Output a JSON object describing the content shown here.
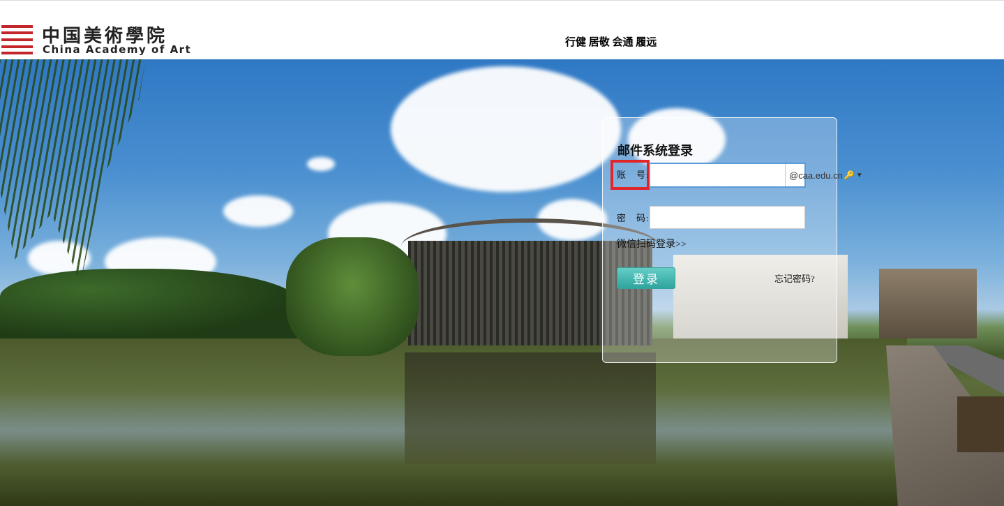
{
  "header": {
    "logo_cn": "中国美術學院",
    "logo_en": "China Academy of Art",
    "motto": "行健 居敬 会通 履远"
  },
  "login": {
    "title": "邮件系统登录",
    "account_label": "账　号:",
    "account_value": "",
    "domain": "@caa.edu.cn",
    "password_label": "密　码:",
    "password_value": "",
    "wechat_link": "微信扫码登录>>",
    "submit_label": "登录",
    "forgot_link": "忘记密码?"
  },
  "colors": {
    "highlight_box": "#e0262b",
    "logo_red": "#c4272b",
    "button_teal": "#2ea59d",
    "field_focus_border": "#5b9bd9"
  },
  "icons": {
    "logo": "caa-logo-mark",
    "domain_dropdown": "chevron-down-icon",
    "domain_key": "key-icon"
  }
}
